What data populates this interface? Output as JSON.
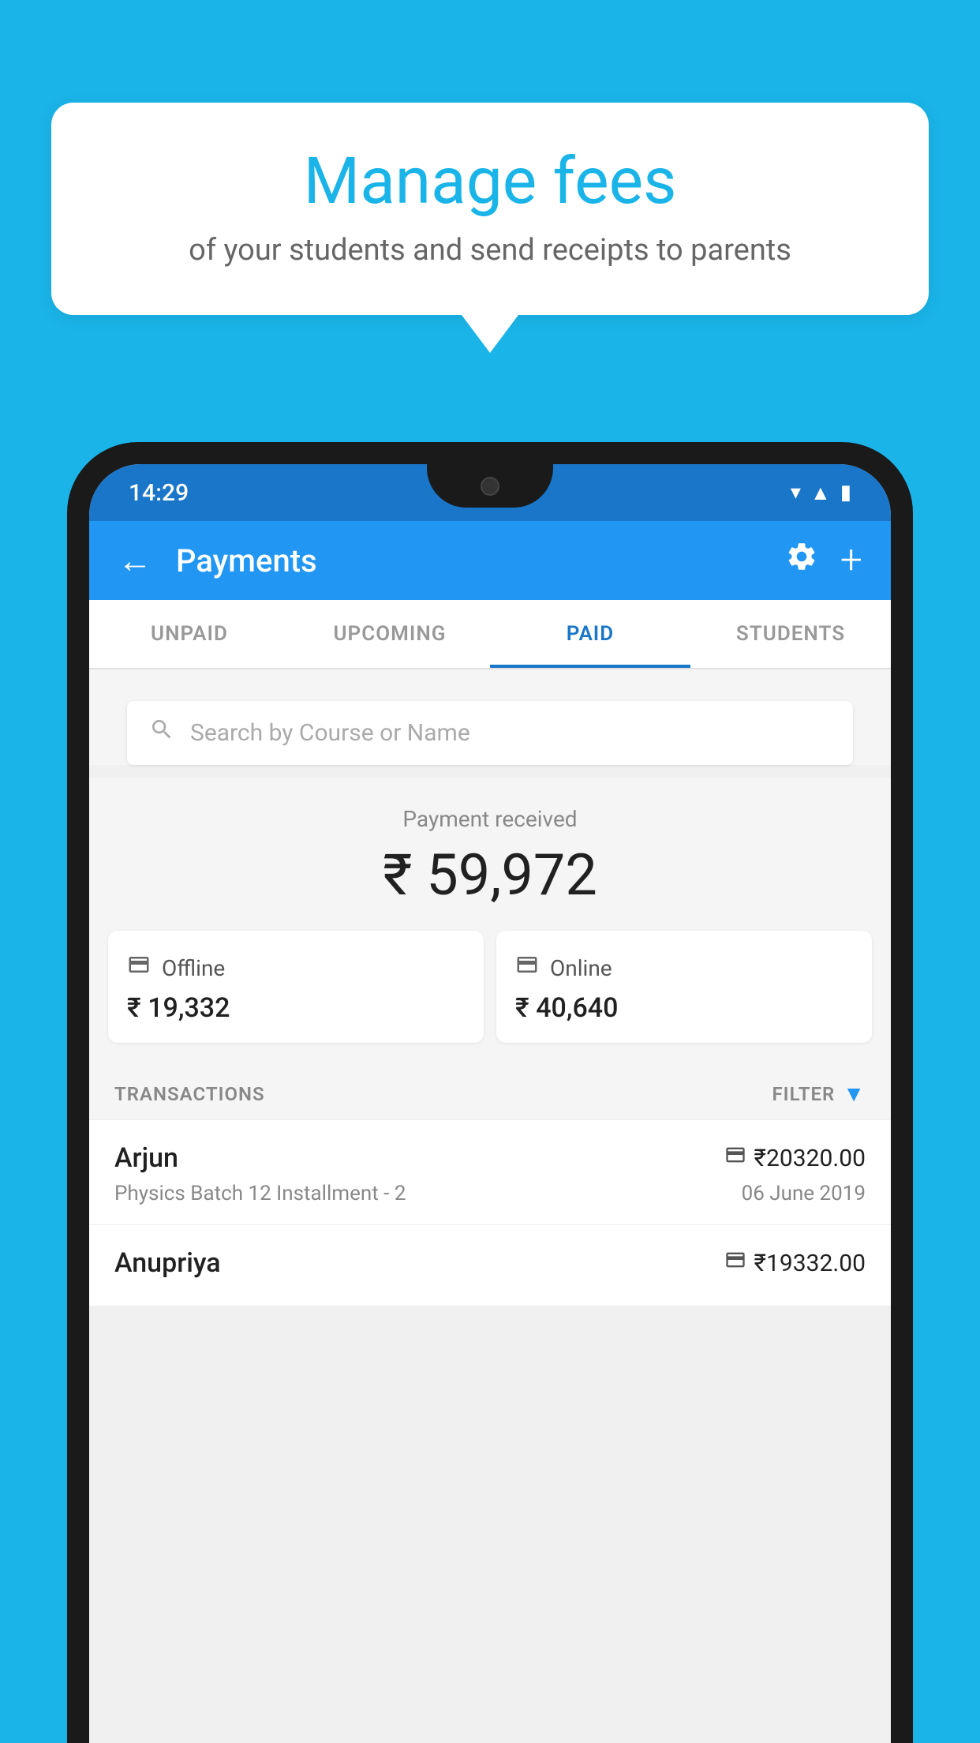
{
  "background_color": "#1ab4e8",
  "speech_bubble": {
    "title": "Manage fees",
    "subtitle": "of your students and send receipts to parents"
  },
  "status_bar": {
    "time": "14:29",
    "icons": [
      "wifi",
      "signal",
      "battery"
    ]
  },
  "app_bar": {
    "title": "Payments",
    "back_label": "←",
    "settings_label": "⚙",
    "add_label": "+"
  },
  "tabs": [
    {
      "label": "UNPAID",
      "active": false
    },
    {
      "label": "UPCOMING",
      "active": false
    },
    {
      "label": "PAID",
      "active": true
    },
    {
      "label": "STUDENTS",
      "active": false
    }
  ],
  "search": {
    "placeholder": "Search by Course or Name"
  },
  "payment_summary": {
    "label": "Payment received",
    "amount": "₹ 59,972",
    "offline_label": "Offline",
    "offline_amount": "₹ 19,332",
    "online_label": "Online",
    "online_amount": "₹ 40,640"
  },
  "transactions": {
    "header_label": "TRANSACTIONS",
    "filter_label": "FILTER",
    "items": [
      {
        "name": "Arjun",
        "amount": "₹20320.00",
        "course": "Physics Batch 12 Installment - 2",
        "date": "06 June 2019",
        "payment_type": "online"
      },
      {
        "name": "Anupriya",
        "amount": "₹19332.00",
        "course": "",
        "date": "",
        "payment_type": "offline"
      }
    ]
  }
}
